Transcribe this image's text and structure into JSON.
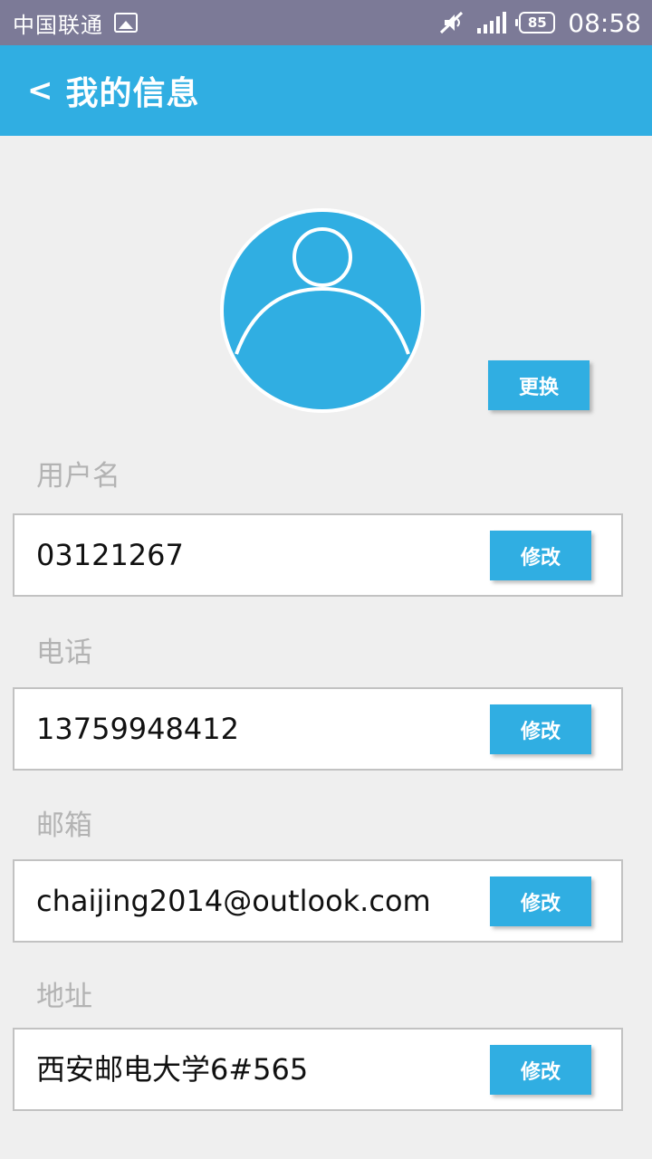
{
  "status_bar": {
    "carrier": "中国联通",
    "battery": "85",
    "time": "08:58",
    "icons": [
      "image-icon",
      "mute-icon",
      "signal-icon",
      "battery-icon"
    ]
  },
  "header": {
    "back": "<",
    "title": "我的信息"
  },
  "avatar": {
    "change_label": "更换",
    "bg_color": "#30aee2"
  },
  "fields": [
    {
      "label": "用户名",
      "value": "03121267",
      "action": "修改"
    },
    {
      "label": "电话",
      "value": "13759948412",
      "action": "修改"
    },
    {
      "label": "邮箱",
      "value": "chaijing2014@outlook.com",
      "action": "修改"
    },
    {
      "label": "地址",
      "value": "西安邮电大学6#565",
      "action": "修改"
    }
  ],
  "colors": {
    "accent": "#30aee2",
    "status_bar": "#7c7a97",
    "background": "#efefef",
    "label_text": "#b3b3b3"
  }
}
